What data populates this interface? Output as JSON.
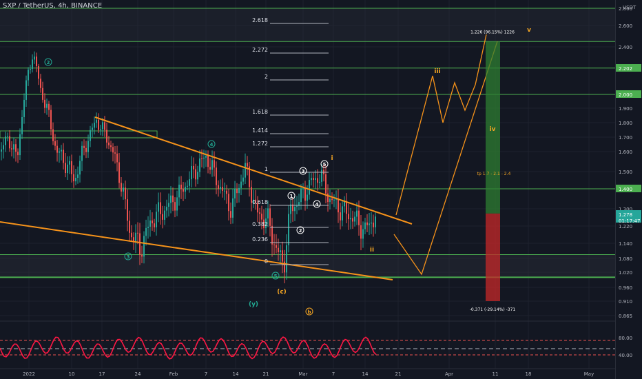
{
  "header": {
    "symbol_title": "SXP / TetherUS, 4h, BINANCE",
    "currency_label": "USDT"
  },
  "colors": {
    "background": "#131722",
    "candle_up": "#26a69a",
    "candle_down": "#ef5350",
    "trendline": "#f7931a",
    "hline": "#4caf50",
    "wave_teal": "#22ab94",
    "wave_orange": "#f5a623",
    "long_profit": "#2e7d32",
    "long_loss": "#c62828",
    "oscillator": "#ff1744"
  },
  "chart_data": {
    "type": "candlestick",
    "y_axis_ticks": [
      "2.800",
      "2.600",
      "2.400",
      "2.200",
      "2.000",
      "1.900",
      "1.800",
      "1.700",
      "1.600",
      "1.500",
      "1.400",
      "1.300",
      "1.220",
      "1.140",
      "1.080",
      "1.020",
      "0.960",
      "0.910",
      "0.865"
    ],
    "x_axis_ticks": [
      "2022",
      "10",
      "17",
      "24",
      "Feb",
      "7",
      "14",
      "21",
      "Mar",
      "7",
      "14",
      "21",
      "Apr",
      "11",
      "18",
      "May"
    ],
    "price_badges": [
      {
        "label": "2.202",
        "kind": "level"
      },
      {
        "label": "2.000",
        "kind": "level"
      },
      {
        "label": "1.400",
        "kind": "level"
      },
      {
        "label": "1.278",
        "kind": "current"
      },
      {
        "label": "01:17:47",
        "kind": "countdown"
      }
    ],
    "horizontal_levels": [
      2.8,
      2.45,
      2.202,
      2.0,
      1.4,
      1.095,
      1.0
    ],
    "fib_levels": [
      {
        "ratio": "2.618"
      },
      {
        "ratio": "2.272"
      },
      {
        "ratio": "2"
      },
      {
        "ratio": "1.618"
      },
      {
        "ratio": "1.414"
      },
      {
        "ratio": "1.272"
      },
      {
        "ratio": "1"
      },
      {
        "ratio": "0.618"
      },
      {
        "ratio": "0.382"
      },
      {
        "ratio": "0.236"
      },
      {
        "ratio": "0"
      }
    ],
    "wave_labels": [
      "2",
      "3",
      "4",
      "5",
      "(y)",
      "(c)",
      "b",
      "1",
      "2",
      "3",
      "4",
      "5",
      "i",
      "ii",
      "iii",
      "iv",
      "v"
    ],
    "position_tool": {
      "entry": 1.278,
      "target": 2.45,
      "stop": 0.91,
      "target_label": "1.226 (96.15%) 1226",
      "stop_label": "-0.371 (-29.14%) -371",
      "tp_label": "tp 1.7 - 2.1 - 2.4"
    },
    "oscillator": {
      "upper_level": "80.00",
      "lower_level": "40.00"
    }
  }
}
